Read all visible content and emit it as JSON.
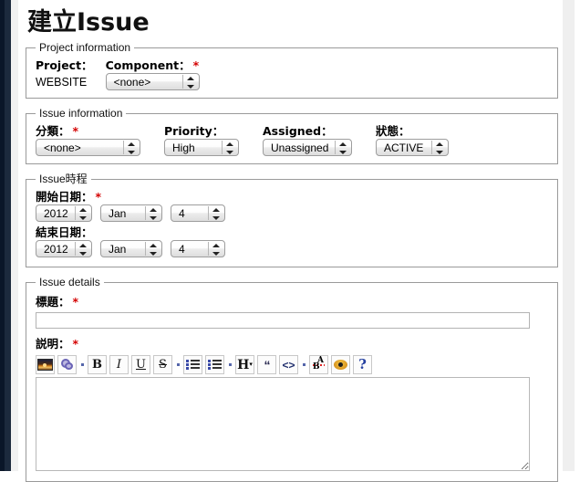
{
  "page": {
    "title": "建立Issue"
  },
  "project_information": {
    "legend": "Project information",
    "project_label": "Project：",
    "project_value": "WEBSITE",
    "component_label": "Component：",
    "component_required": "*",
    "component_value": "<none>"
  },
  "issue_information": {
    "legend": "Issue information",
    "category_label": "分類：",
    "category_required": "*",
    "category_value": "<none>",
    "priority_label": "Priority：",
    "priority_value": "High",
    "assigned_label": "Assigned：",
    "assigned_value": "Unassigned",
    "status_label": "狀態：",
    "status_value": "ACTIVE"
  },
  "issue_schedule": {
    "legend": "Issue時程",
    "start_label": "開始日期：",
    "start_required": "*",
    "start_year": "2012",
    "start_month": "Jan",
    "start_day": "4",
    "end_label": "結束日期：",
    "end_year": "2012",
    "end_month": "Jan",
    "end_day": "4"
  },
  "issue_details": {
    "legend": "Issue details",
    "subject_label": "標題：",
    "subject_required": "*",
    "subject_value": "",
    "subject_placeholder": "",
    "description_label": "説明：",
    "description_required": "*",
    "description_value": "",
    "toolbar": [
      {
        "name": "insert-image-icon",
        "title": "Image"
      },
      {
        "name": "insert-link-icon",
        "title": "Link"
      },
      {
        "name": "separator",
        "title": ""
      },
      {
        "name": "bold-icon",
        "title": "Bold",
        "glyph": "B"
      },
      {
        "name": "italic-icon",
        "title": "Italic",
        "glyph": "I"
      },
      {
        "name": "underline-icon",
        "title": "Underline",
        "glyph": "U"
      },
      {
        "name": "strikethrough-icon",
        "title": "Strikethrough",
        "glyph": "S"
      },
      {
        "name": "separator",
        "title": ""
      },
      {
        "name": "ordered-list-icon",
        "title": "Ordered list"
      },
      {
        "name": "unordered-list-icon",
        "title": "Unordered list"
      },
      {
        "name": "separator",
        "title": ""
      },
      {
        "name": "heading-icon",
        "title": "Heading",
        "glyph": "H"
      },
      {
        "name": "blockquote-icon",
        "title": "Quote",
        "glyph": "“"
      },
      {
        "name": "code-icon",
        "title": "Code",
        "glyph": "<>"
      },
      {
        "name": "separator",
        "title": ""
      },
      {
        "name": "text-color-icon",
        "title": "Text color"
      },
      {
        "name": "emoticon-icon",
        "title": "Emoticon"
      },
      {
        "name": "help-icon",
        "title": "Help",
        "glyph": "?"
      }
    ]
  },
  "colors": {
    "required_mark": "#d40000",
    "sidebar_dark": "#0a1628",
    "sidebar_navy": "#1c2a3d",
    "fieldset_border": "#9a9a9a",
    "page_background": "#ffffff"
  }
}
